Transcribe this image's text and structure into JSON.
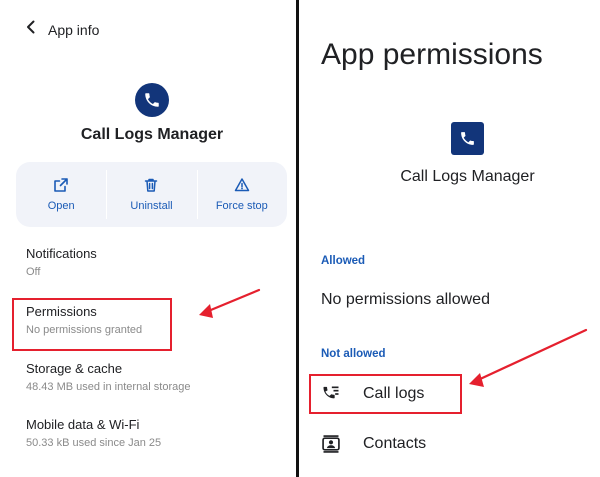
{
  "left": {
    "header": {
      "title": "App info"
    },
    "app_name": "Call Logs Manager",
    "actions": [
      {
        "label": "Open",
        "icon": "open-external-icon"
      },
      {
        "label": "Uninstall",
        "icon": "trash-icon"
      },
      {
        "label": "Force stop",
        "icon": "warning-icon"
      }
    ],
    "settings": {
      "notifications": {
        "title": "Notifications",
        "subtitle": "Off"
      },
      "permissions": {
        "title": "Permissions",
        "subtitle": "No permissions granted"
      },
      "storage": {
        "title": "Storage & cache",
        "subtitle": "48.43 MB used in internal storage"
      },
      "mobile_data": {
        "title": "Mobile data & Wi-Fi",
        "subtitle": "50.33 kB used since Jan 25"
      }
    }
  },
  "right": {
    "title": "App permissions",
    "app_name": "Call Logs Manager",
    "allowed_label": "Allowed",
    "allowed_empty": "No permissions allowed",
    "not_allowed_label": "Not allowed",
    "permissions": [
      {
        "label": "Call logs",
        "icon": "call-log-icon"
      },
      {
        "label": "Contacts",
        "icon": "contacts-icon"
      }
    ]
  },
  "colors": {
    "accent": "#1b5bb6",
    "app_icon_bg": "#12357a",
    "highlight": "#e5202e"
  }
}
